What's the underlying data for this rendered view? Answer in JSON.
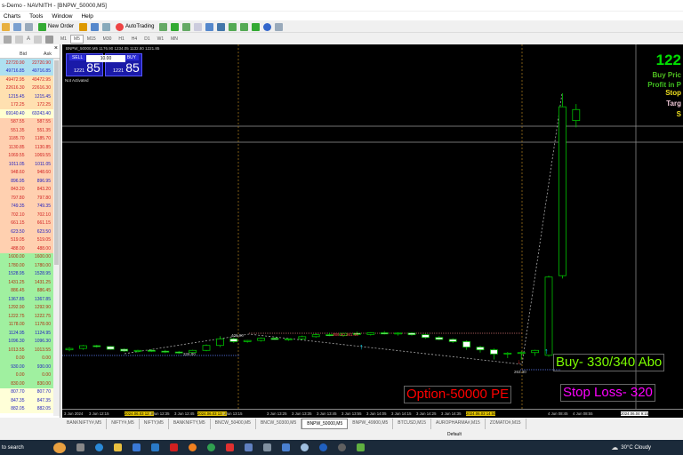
{
  "window": {
    "title": "s-Demo - NAVNITH - [BNPW_50000,M5]"
  },
  "menu": [
    "Charts",
    "Tools",
    "Window",
    "Help"
  ],
  "toolbar": {
    "new_order": "New Order",
    "autotrading": "AutoTrading",
    "timeframes": [
      "M1",
      "M5",
      "M15",
      "M30",
      "H1",
      "H4",
      "D1",
      "W1",
      "MN"
    ],
    "active_timeframe": "M5"
  },
  "market_watch": {
    "bid_label": "Bid",
    "ask_label": "Ask",
    "close": "×",
    "rows": [
      {
        "bid": "22720.90",
        "ask": "22720.90",
        "bg": "#aee0f0",
        "fg": "#d02020"
      },
      {
        "bid": "49716.85",
        "ask": "49716.85",
        "bg": "#aee0f0",
        "fg": "#2020c0"
      },
      {
        "bid": "49472.95",
        "ask": "49472.95",
        "bg": "#ffe0b0",
        "fg": "#d02020"
      },
      {
        "bid": "22616.30",
        "ask": "22616.30",
        "bg": "#ffe0b0",
        "fg": "#d02020"
      },
      {
        "bid": "1215.45",
        "ask": "1215.45",
        "bg": "#ffe0b0",
        "fg": "#2020c0"
      },
      {
        "bid": "172.25",
        "ask": "172.25",
        "bg": "#ffe0b0",
        "fg": "#d02020"
      },
      {
        "bid": "69140.40",
        "ask": "69243.40",
        "bg": "#ffffd0",
        "fg": "#2020c0"
      },
      {
        "bid": "587.55",
        "ask": "587.55",
        "bg": "#ffd0b0",
        "fg": "#d02020"
      },
      {
        "bid": "551.35",
        "ask": "551.35",
        "bg": "#ffd0b0",
        "fg": "#d02020"
      },
      {
        "bid": "1185.70",
        "ask": "1185.70",
        "bg": "#ffd0b0",
        "fg": "#d02020"
      },
      {
        "bid": "1130.85",
        "ask": "1130.85",
        "bg": "#ffd0b0",
        "fg": "#d02020"
      },
      {
        "bid": "1069.55",
        "ask": "1069.55",
        "bg": "#ffd0b0",
        "fg": "#d02020"
      },
      {
        "bid": "1011.05",
        "ask": "1011.05",
        "bg": "#ffd0b0",
        "fg": "#2020c0"
      },
      {
        "bid": "948.60",
        "ask": "948.60",
        "bg": "#ffd0b0",
        "fg": "#d02020"
      },
      {
        "bid": "896.95",
        "ask": "896.95",
        "bg": "#ffd0b0",
        "fg": "#2020c0"
      },
      {
        "bid": "843.20",
        "ask": "843.20",
        "bg": "#ffd0b0",
        "fg": "#d02020"
      },
      {
        "bid": "797.80",
        "ask": "797.80",
        "bg": "#ffd0b0",
        "fg": "#d02020"
      },
      {
        "bid": "749.35",
        "ask": "749.35",
        "bg": "#ffd0b0",
        "fg": "#2020c0"
      },
      {
        "bid": "702.10",
        "ask": "702.10",
        "bg": "#ffd0b0",
        "fg": "#d02020"
      },
      {
        "bid": "661.15",
        "ask": "661.15",
        "bg": "#ffd0b0",
        "fg": "#d02020"
      },
      {
        "bid": "623.50",
        "ask": "623.50",
        "bg": "#ffd0b0",
        "fg": "#2020c0"
      },
      {
        "bid": "519.05",
        "ask": "519.05",
        "bg": "#ffd0b0",
        "fg": "#d02020"
      },
      {
        "bid": "488.00",
        "ask": "488.00",
        "bg": "#ffd0b0",
        "fg": "#d02020"
      },
      {
        "bid": "1600.00",
        "ask": "1600.00",
        "bg": "#a0f0a0",
        "fg": "#b03010"
      },
      {
        "bid": "1780.00",
        "ask": "1780.00",
        "bg": "#a0f0a0",
        "fg": "#b03010"
      },
      {
        "bid": "1528.95",
        "ask": "1528.95",
        "bg": "#a0f0a0",
        "fg": "#2020c0"
      },
      {
        "bid": "1431.25",
        "ask": "1431.25",
        "bg": "#a0f0a0",
        "fg": "#b03010"
      },
      {
        "bid": "886.45",
        "ask": "886.45",
        "bg": "#a0f0a0",
        "fg": "#b03010"
      },
      {
        "bid": "1367.85",
        "ask": "1367.85",
        "bg": "#a0f0a0",
        "fg": "#2020c0"
      },
      {
        "bid": "1292.90",
        "ask": "1292.90",
        "bg": "#a0f0a0",
        "fg": "#b03010"
      },
      {
        "bid": "1222.75",
        "ask": "1222.75",
        "bg": "#a0f0a0",
        "fg": "#b03010"
      },
      {
        "bid": "1178.00",
        "ask": "1178.00",
        "bg": "#a0f0a0",
        "fg": "#b03010"
      },
      {
        "bid": "1124.95",
        "ask": "1124.95",
        "bg": "#a0f0a0",
        "fg": "#2020c0"
      },
      {
        "bid": "1096.30",
        "ask": "1096.30",
        "bg": "#a0f0a0",
        "fg": "#2020c0"
      },
      {
        "bid": "1013.55",
        "ask": "1013.55",
        "bg": "#a0f0a0",
        "fg": "#b03010"
      },
      {
        "bid": "0.00",
        "ask": "0.00",
        "bg": "#a0f0a0",
        "fg": "#b03010"
      },
      {
        "bid": "930.00",
        "ask": "930.00",
        "bg": "#a0f0a0",
        "fg": "#2020c0"
      },
      {
        "bid": "0.00",
        "ask": "0.00",
        "bg": "#a0f0a0",
        "fg": "#b03010"
      },
      {
        "bid": "830.00",
        "ask": "830.00",
        "bg": "#a0f0a0",
        "fg": "#b03010"
      },
      {
        "bid": "807.70",
        "ask": "807.70",
        "bg": "#ffffd8",
        "fg": "#2020c0"
      },
      {
        "bid": "847.35",
        "ask": "847.35",
        "bg": "#ffffd8",
        "fg": "#2020c0"
      },
      {
        "bid": "882.05",
        "ask": "882.05",
        "bg": "#ffffd8",
        "fg": "#2020c0"
      }
    ]
  },
  "chart": {
    "header": "BNPW_50000,M5  1176.90 1234.05 1132.80 1221.85",
    "one_click": {
      "sell": "SELL",
      "buy": "BUY",
      "lot": "10.00",
      "sell_price_small": "1221",
      "sell_price_big": "85",
      "buy_price_small": "1221",
      "buy_price_big": "85",
      "status": "Not Activated"
    },
    "info": {
      "price": "122",
      "buy_price": "Buy Pric",
      "profit": "Profit in P",
      "stop": "Stop",
      "target": "Targ",
      "s": "S"
    },
    "price_labels": {
      "low1": "326.00",
      "high1": "406.90",
      "low2": "263.30",
      "mark": "369.90 361.46"
    },
    "text_boxes": {
      "buy": "Buy- 330/340 Abo",
      "option": "Option-50000 PE",
      "stoploss": "Stop Loss- 320"
    },
    "colors": {
      "bull": "#00c000",
      "bear_body": "#ffffff",
      "buy_text": "#7cfc00",
      "option_text": "#ff0000",
      "stop_text": "#ff00ff"
    },
    "candles": [
      [
        300,
        310,
        295,
        305
      ],
      [
        305,
        318,
        300,
        315
      ],
      [
        315,
        318,
        308,
        312
      ],
      [
        312,
        314,
        300,
        302
      ],
      [
        302,
        305,
        292,
        296
      ],
      [
        296,
        300,
        290,
        298
      ],
      [
        298,
        302,
        293,
        295
      ],
      [
        295,
        300,
        288,
        292
      ],
      [
        292,
        296,
        285,
        290
      ],
      [
        290,
        300,
        287,
        298
      ],
      [
        298,
        320,
        295,
        316
      ],
      [
        316,
        350,
        310,
        340
      ],
      [
        340,
        345,
        325,
        330
      ],
      [
        330,
        336,
        326,
        334
      ],
      [
        334,
        345,
        330,
        342
      ],
      [
        342,
        346,
        336,
        338
      ],
      [
        338,
        342,
        333,
        340
      ],
      [
        340,
        352,
        336,
        348
      ],
      [
        348,
        360,
        344,
        355
      ],
      [
        355,
        362,
        350,
        352
      ],
      [
        352,
        362,
        348,
        360
      ],
      [
        360,
        366,
        354,
        356
      ],
      [
        356,
        364,
        352,
        362
      ],
      [
        362,
        368,
        356,
        358
      ],
      [
        358,
        364,
        352,
        361
      ],
      [
        361,
        364,
        352,
        355
      ],
      [
        355,
        358,
        340,
        345
      ],
      [
        345,
        350,
        335,
        338
      ],
      [
        338,
        342,
        325,
        330
      ],
      [
        330,
        334,
        300,
        310
      ],
      [
        310,
        315,
        290,
        300
      ],
      [
        300,
        305,
        265,
        285
      ],
      [
        285,
        292,
        270,
        288
      ],
      [
        288,
        295,
        263,
        290
      ],
      [
        290,
        300,
        278,
        298
      ],
      [
        280,
        570,
        275,
        565
      ],
      [
        570,
        1234,
        560,
        1185
      ],
      [
        1135,
        1195,
        1110,
        1175
      ]
    ],
    "time_labels": [
      {
        "t": "3 Jun 2024"
      },
      {
        "t": "3 Jun 12:15"
      },
      {
        "t": "2024.06.03 12:30",
        "hl": "y"
      },
      {
        "t": "3 Jun 12:35"
      },
      {
        "t": "3 Jun 12:45"
      },
      {
        "t": "2024.06.03 13:10",
        "hl": "y"
      },
      {
        "t": "3 Jun 13:15"
      },
      {
        "t": "3 Jun 13:25"
      },
      {
        "t": "3 Jun 13:35"
      },
      {
        "t": "3 Jun 13:45"
      },
      {
        "t": "3 Jun 13:55"
      },
      {
        "t": "3 Jun 14:05"
      },
      {
        "t": "3 Jun 14:15"
      },
      {
        "t": "3 Jun 14:25"
      },
      {
        "t": "3 Jun 14:35"
      },
      {
        "t": "2024.06.03 14:50",
        "hl": "y"
      },
      {
        "t": "4 Jun 08:45"
      },
      {
        "t": "4 Jun 08:55"
      },
      {
        "t": "2024.06.04 9:15",
        "hl": "w"
      }
    ]
  },
  "tabs": [
    "BANKNIFTY#,M5",
    "NIFTY#,M5",
    "NIFTY,M5",
    "BANKNIFTY,M5",
    "BNCW_50400,M5",
    "BNCW_50300,M5",
    "BNPW_50000,M5",
    "BNPW_49900,M5",
    "BTCUSD,M15",
    "AUROPHARMA#,M15",
    "ZOMATO#,M15"
  ],
  "active_tab": "BNPW_50000,M5",
  "status": {
    "profile": "Default"
  },
  "taskbar": {
    "search": "to search",
    "weather": "30°C  Cloudy"
  }
}
